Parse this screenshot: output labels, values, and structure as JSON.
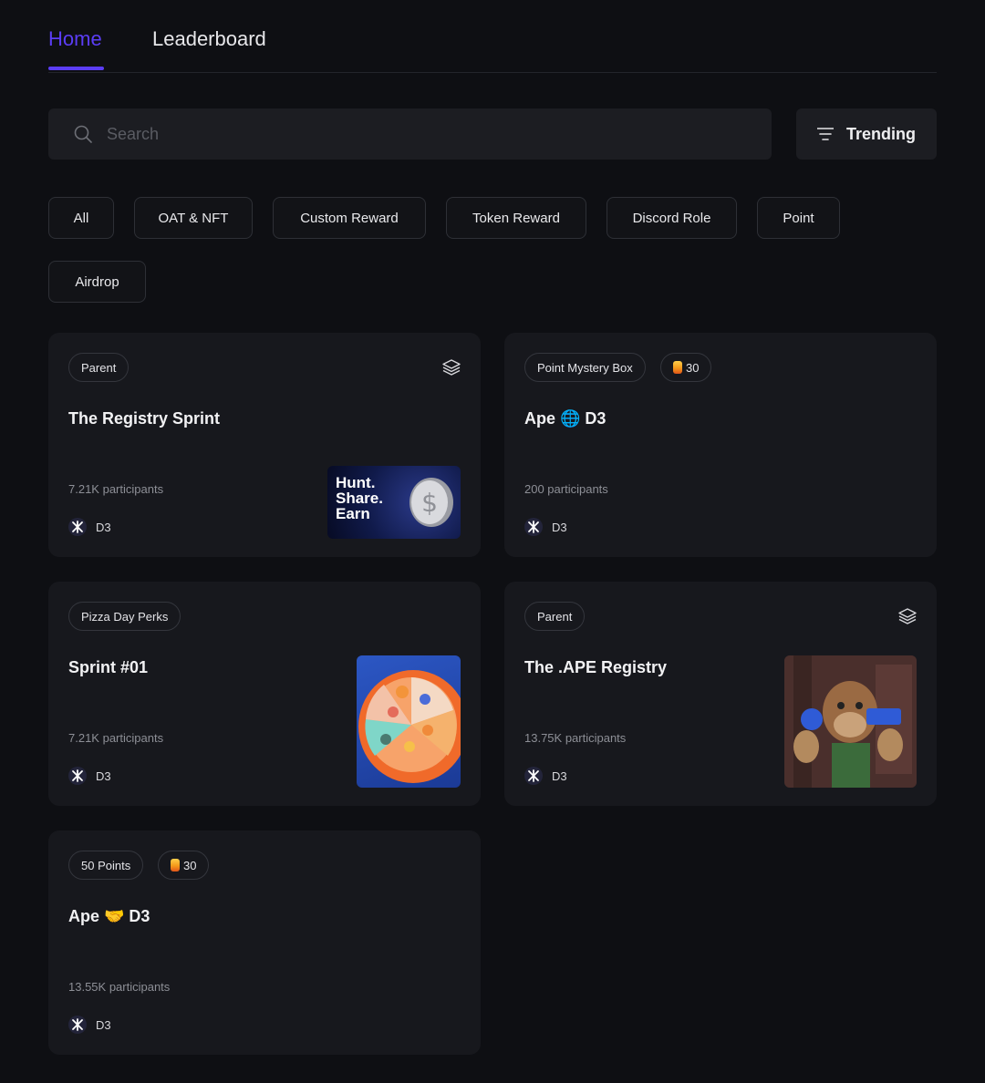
{
  "tabs": [
    {
      "label": "Home",
      "active": true
    },
    {
      "label": "Leaderboard",
      "active": false
    }
  ],
  "search": {
    "placeholder": "Search",
    "value": ""
  },
  "sort_button": {
    "label": "Trending",
    "icon": "filter-icon"
  },
  "filters": [
    "All",
    "OAT & NFT",
    "Custom Reward",
    "Token Reward",
    "Discord Role",
    "Point",
    "Airdrop"
  ],
  "cards": [
    {
      "badges": [
        {
          "label": "Parent"
        }
      ],
      "stack_icon": true,
      "title": "The Registry Sprint",
      "participants": "7.21K participants",
      "brand": "D3",
      "thumbnail": "hunt-share-earn-coin",
      "thumbnail_text": [
        "Hunt.",
        "Share.",
        "Earn"
      ]
    },
    {
      "badges": [
        {
          "label": "Point Mystery Box"
        },
        {
          "label": "30",
          "icon": "gem-icon"
        }
      ],
      "stack_icon": false,
      "title": "Ape 🌐 D3",
      "participants": "200 participants",
      "brand": "D3"
    },
    {
      "badges": [
        {
          "label": "Pizza Day Perks"
        }
      ],
      "stack_icon": false,
      "title": "Sprint #01",
      "participants": "7.21K participants",
      "brand": "D3",
      "thumbnail": "pizza-illustration"
    },
    {
      "badges": [
        {
          "label": "Parent"
        }
      ],
      "stack_icon": true,
      "title": "The .APE Registry",
      "participants": "13.75K participants",
      "brand": "D3",
      "thumbnail": "ape-illustration"
    },
    {
      "badges": [
        {
          "label": "50 Points"
        },
        {
          "label": "30",
          "icon": "gem-icon"
        }
      ],
      "stack_icon": false,
      "title": "Ape 🤝 D3",
      "participants": "13.55K participants",
      "brand": "D3"
    }
  ],
  "colors": {
    "accent": "#5b3df5",
    "background": "#0e0f13",
    "card": "#17181d"
  }
}
